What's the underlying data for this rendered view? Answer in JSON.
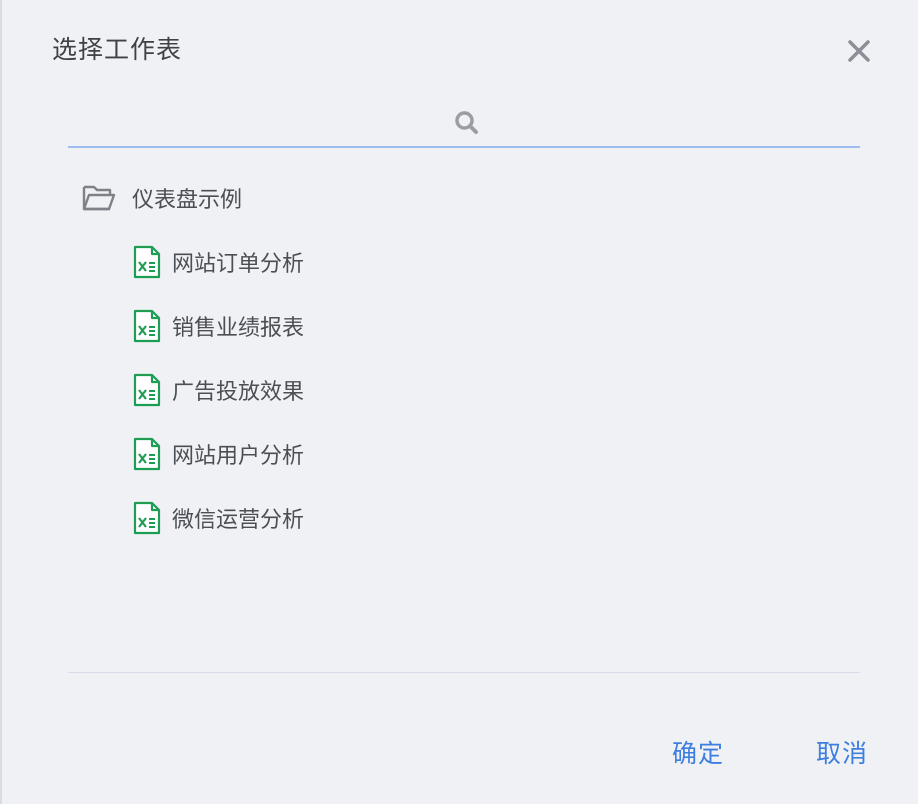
{
  "dialog": {
    "title": "选择工作表",
    "close_icon": "close-icon"
  },
  "search": {
    "value": "",
    "placeholder": "",
    "icon": "search-icon"
  },
  "tree": {
    "folder": {
      "label": "仪表盘示例",
      "icon": "folder-open-icon"
    },
    "sheets": [
      {
        "label": "网站订单分析",
        "icon": "spreadsheet-icon"
      },
      {
        "label": "销售业绩报表",
        "icon": "spreadsheet-icon"
      },
      {
        "label": "广告投放效果",
        "icon": "spreadsheet-icon"
      },
      {
        "label": "网站用户分析",
        "icon": "spreadsheet-icon"
      },
      {
        "label": "微信运营分析",
        "icon": "spreadsheet-icon"
      }
    ]
  },
  "footer": {
    "confirm_label": "确定",
    "cancel_label": "取消"
  },
  "colors": {
    "background": "#f0f1f4",
    "accent": "#3d7ee0",
    "sheet_icon": "#1f9d55",
    "search_underline": "#9cbef0"
  }
}
